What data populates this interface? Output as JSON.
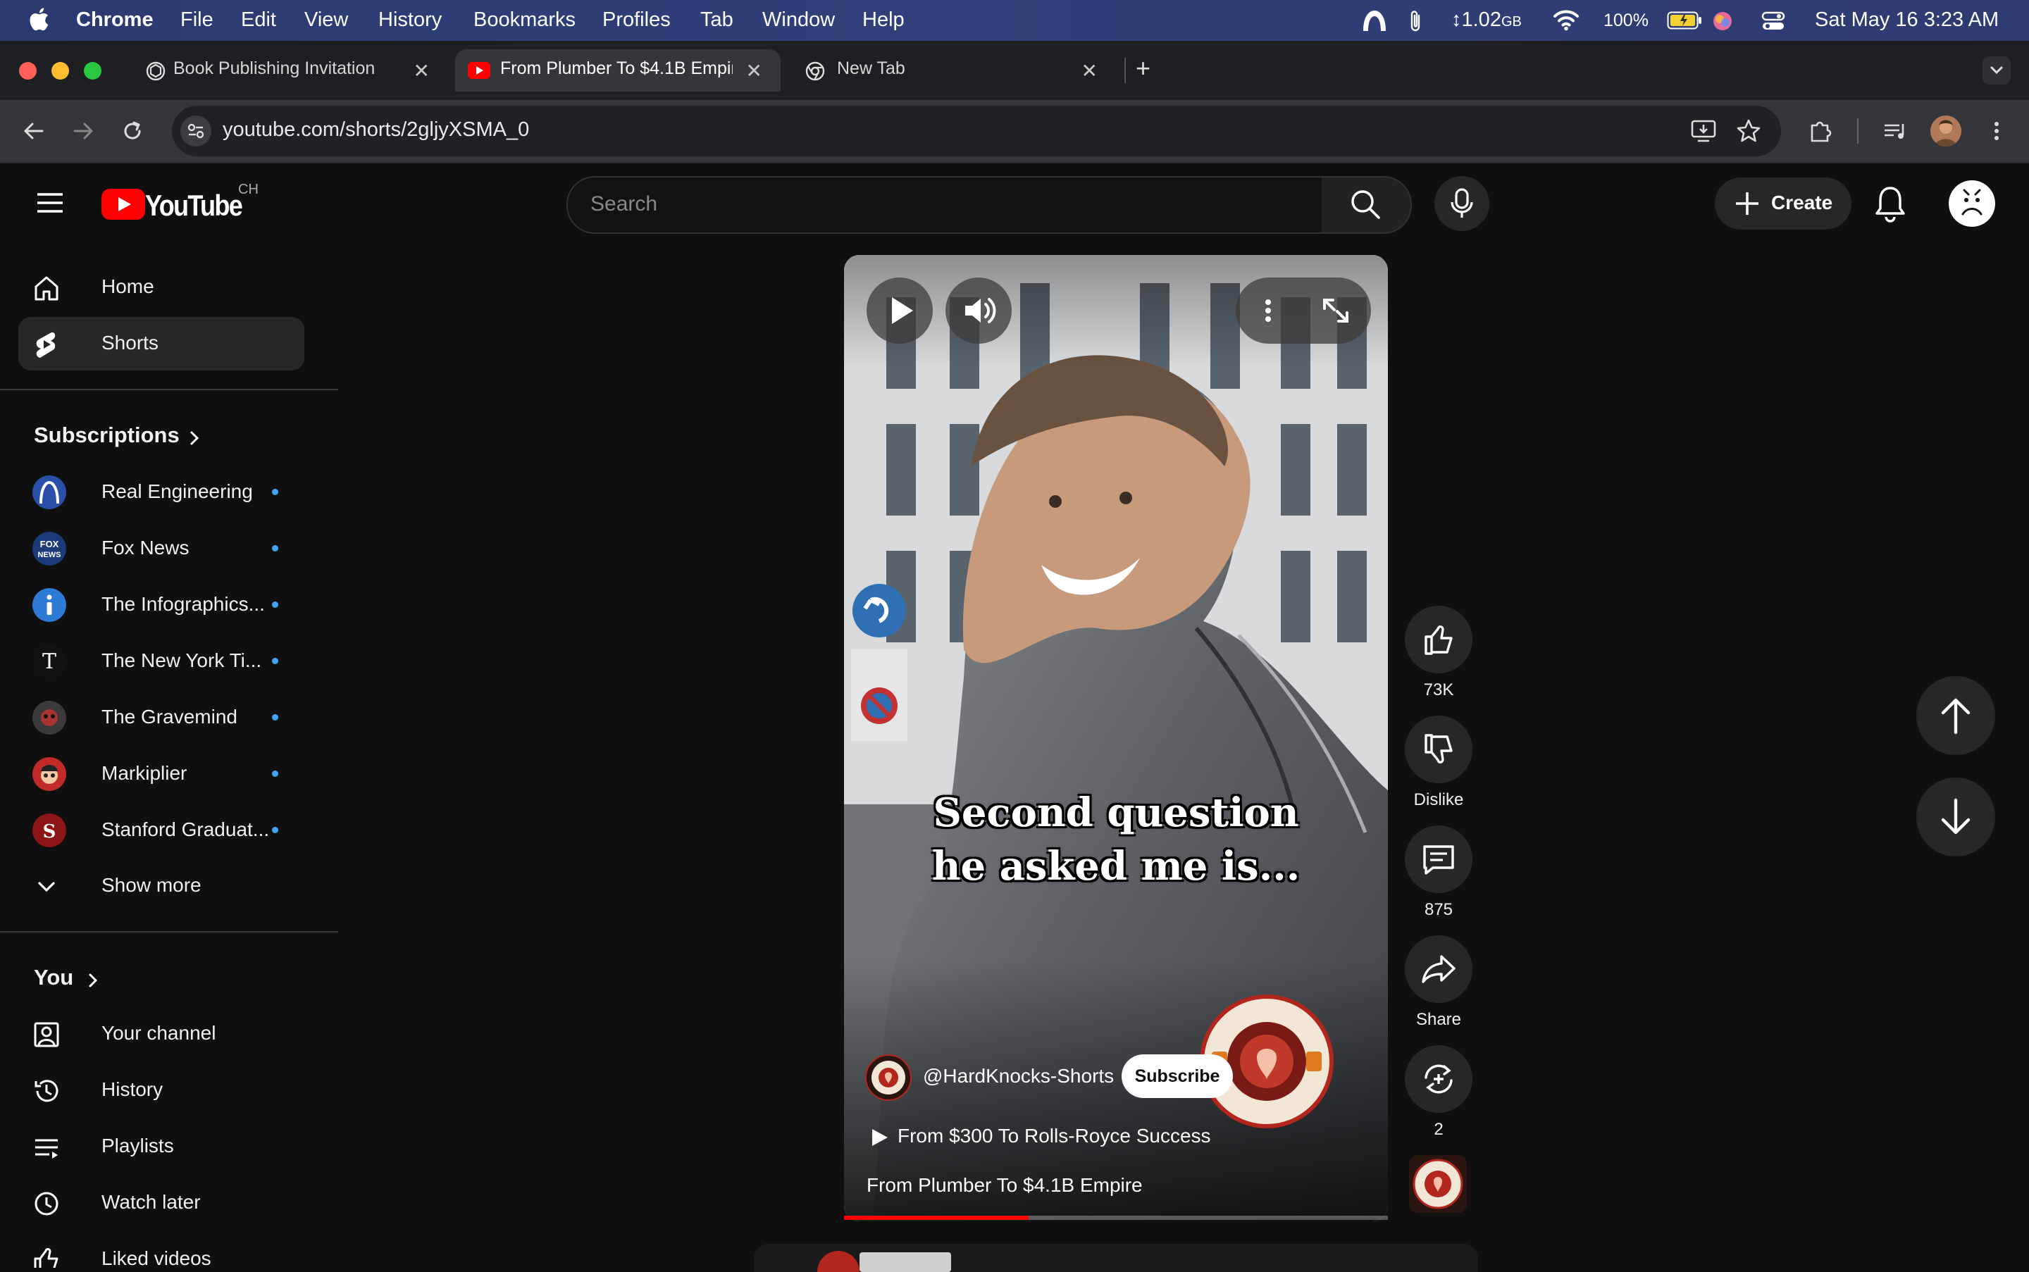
{
  "menubar": {
    "app": "Chrome",
    "items": [
      "File",
      "Edit",
      "View",
      "History",
      "Bookmarks",
      "Profiles",
      "Tab",
      "Window",
      "Help"
    ],
    "memory": "1.02",
    "memory_unit": "GB",
    "battery": "100%",
    "datetime": "Sat May 16  3:23 AM"
  },
  "tabs": [
    {
      "title": "Book Publishing Invitation",
      "active": false
    },
    {
      "title": "From Plumber To $4.1B Empir",
      "active": true
    },
    {
      "title": "New Tab",
      "active": false
    }
  ],
  "address": {
    "url": "youtube.com/shorts/2gljyXSMA_0"
  },
  "youtube": {
    "logo_text": "YouTube",
    "country": "CH",
    "search_placeholder": "Search",
    "create_label": "Create"
  },
  "sidebar": {
    "main": [
      {
        "label": "Home",
        "icon": "home-icon",
        "active": false
      },
      {
        "label": "Shorts",
        "icon": "shorts-icon",
        "active": true
      }
    ],
    "subscriptions_header": "Subscriptions",
    "subscriptions": [
      {
        "label": "Real Engineering",
        "color": "#2a4fa8"
      },
      {
        "label": "Fox News",
        "color": "#1b3a7a"
      },
      {
        "label": "The Infographics...",
        "color": "#2e7bd6"
      },
      {
        "label": "The New York Ti...",
        "color": "#111111"
      },
      {
        "label": "The Gravemind",
        "color": "#3a3a3a"
      },
      {
        "label": "Markiplier",
        "color": "#c22a2a"
      },
      {
        "label": "Stanford Graduat...",
        "color": "#8c1515"
      }
    ],
    "show_more": "Show more",
    "you_header": "You",
    "you": [
      {
        "label": "Your channel",
        "icon": "your-channel-icon"
      },
      {
        "label": "History",
        "icon": "history-icon"
      },
      {
        "label": "Playlists",
        "icon": "playlists-icon"
      },
      {
        "label": "Watch later",
        "icon": "watch-later-icon"
      },
      {
        "label": "Liked videos",
        "icon": "liked-videos-icon"
      }
    ]
  },
  "short": {
    "caption_line1": "Second question",
    "caption_line2": "he asked me is...",
    "channel": "@HardKnocks-Shorts",
    "subscribe": "Subscribe",
    "sound_title": "From $300 To Rolls-Royce Success",
    "title": "From Plumber To $4.1B Empire",
    "progress": 0.34
  },
  "actions": {
    "likes": "73K",
    "dislike": "Dislike",
    "comments": "875",
    "share": "Share",
    "remix": "2"
  }
}
